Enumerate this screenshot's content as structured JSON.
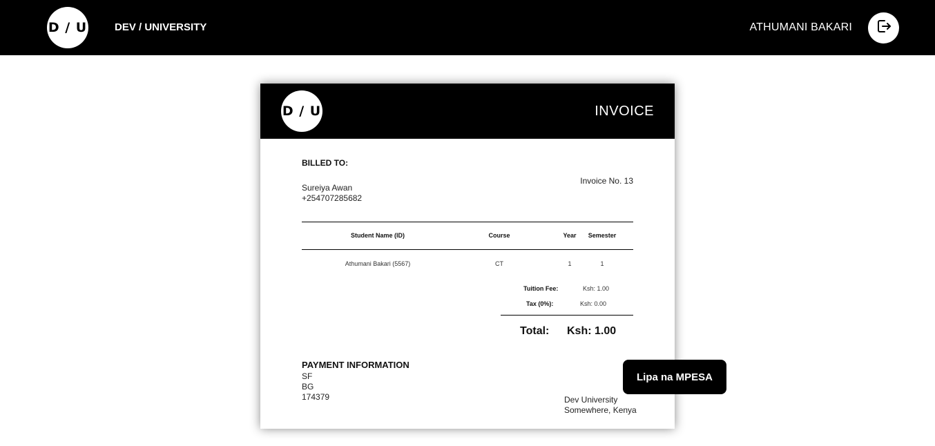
{
  "navbar": {
    "logo_text": "D / U",
    "brand": "DEV / UNIVERSITY",
    "username": "ATHUMANI BAKARI",
    "logout_icon": "logout-icon"
  },
  "invoice": {
    "logo_text": "D / U",
    "title": "INVOICE",
    "billed_to_label": "BILLED TO:",
    "billed_name": "Sureiya Awan",
    "billed_phone": "+254707285682",
    "invoice_no": "Invoice No. 13",
    "table": {
      "headers": [
        "Student Name (ID)",
        "Course",
        "Year",
        "Semester"
      ],
      "rows": [
        [
          "Athumani Bakari (5567)",
          "CT",
          "1",
          "1"
        ]
      ]
    },
    "tuition_label": "Tuition Fee:",
    "tuition_value": "Ksh: 1.00",
    "tax_label": "Tax (0%):",
    "tax_value": "Ksh: 0.00",
    "total_label": "Total:",
    "total_value": "Ksh: 1.00",
    "payment_label": "PAYMENT INFORMATION",
    "payment_lines": [
      "SF",
      "BG",
      "174379"
    ],
    "address_lines": [
      "Dev University",
      "Somewhere, Kenya"
    ]
  },
  "actions": {
    "mpesa_label": "Lipa na MPESA"
  }
}
